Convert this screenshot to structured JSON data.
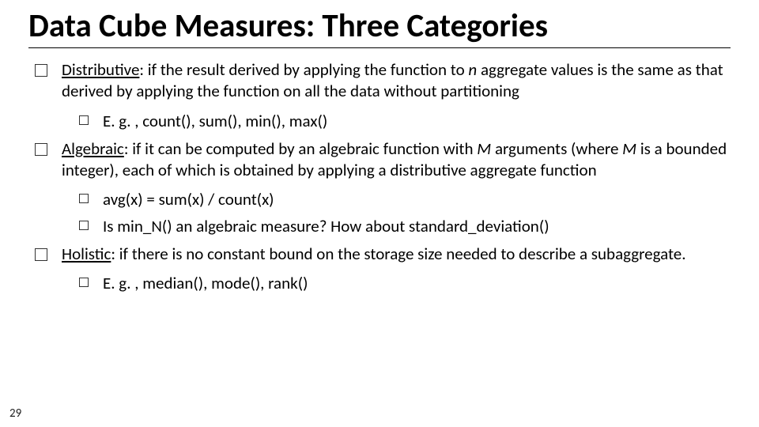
{
  "title": "Data Cube Measures: Three Categories",
  "items": [
    {
      "term": "Distributive",
      "colon": ": ",
      "text_before_n": "if the result derived by applying the function to ",
      "n": "n",
      "text_after_n": " aggregate values is the same as that derived by applying the function on all the data without partitioning",
      "subs": [
        "E. g. , count(), sum(), min(), max()"
      ]
    },
    {
      "term": "Algebraic",
      "colon": ": ",
      "text_before_m": "if it can be computed by an algebraic function with ",
      "m1": "M",
      "text_mid": " arguments (where ",
      "m2": "M",
      "text_after_m": " is a bounded integer), each of which is obtained by applying a distributive aggregate function",
      "subs": [
        "avg(x) = sum(x) / count(x)",
        "Is min_N() an algebraic measure? How about standard_deviation()"
      ]
    },
    {
      "term": "Holistic",
      "colon": ": ",
      "text_plain": "if there is no constant bound on the storage size needed to describe a subaggregate.",
      "subs": [
        "E. g. , median(), mode(), rank()"
      ]
    }
  ],
  "page_number": "29"
}
